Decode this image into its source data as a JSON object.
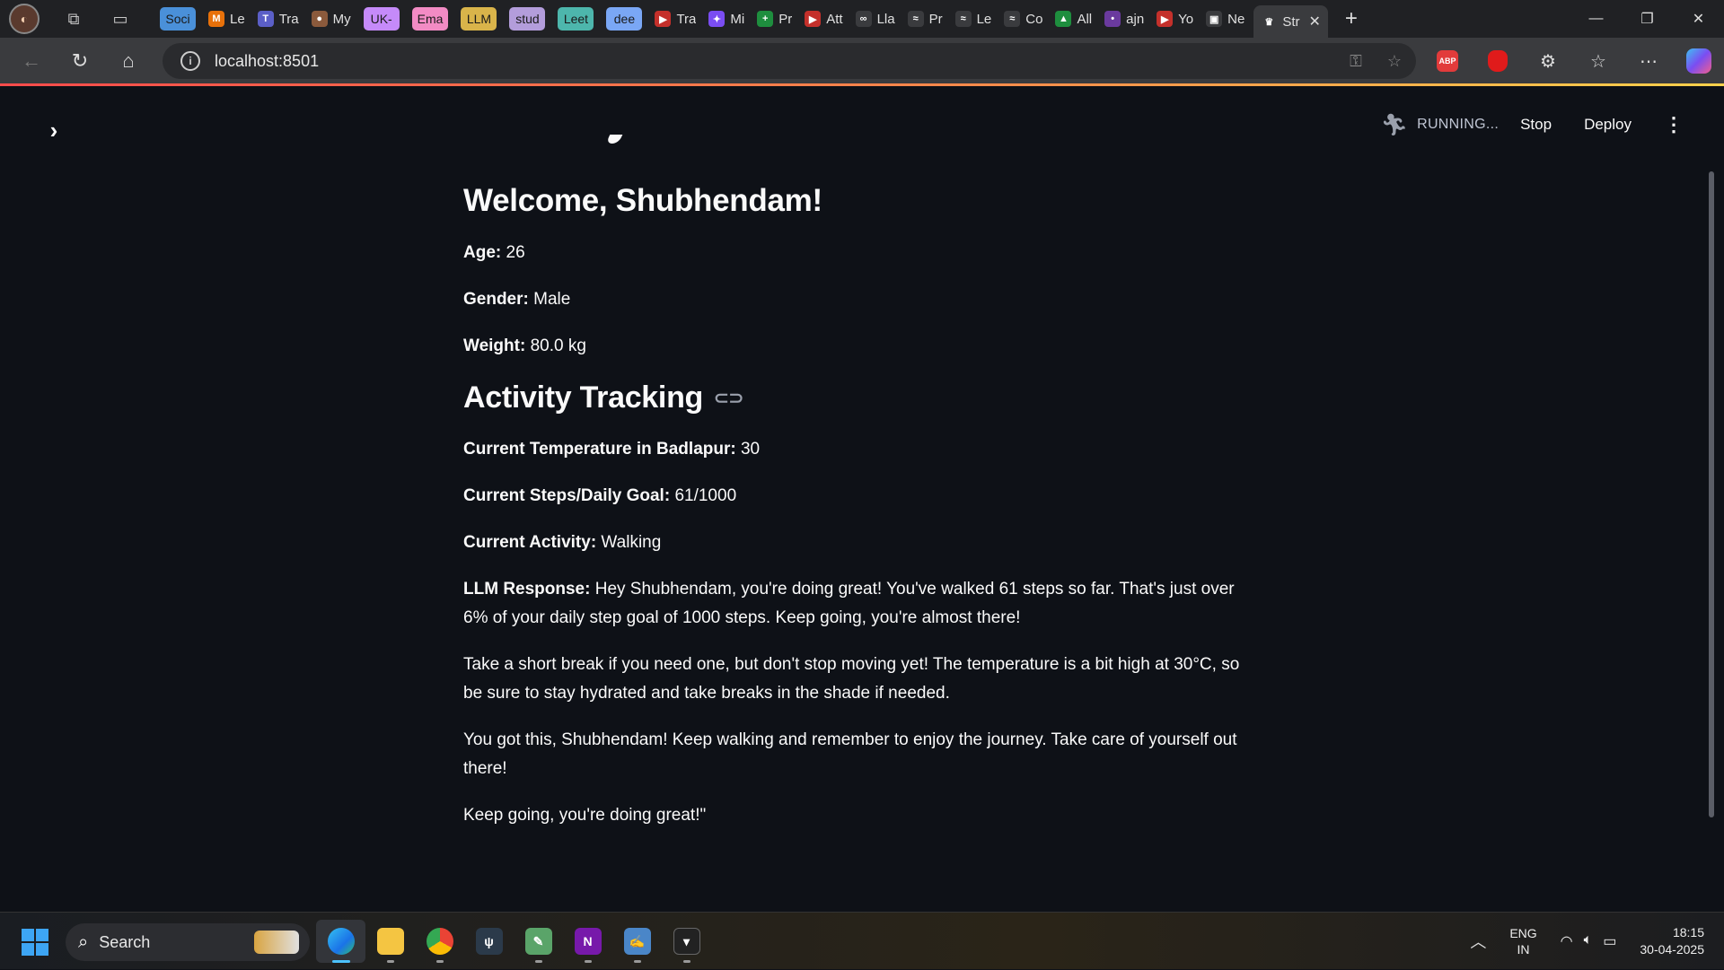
{
  "browser": {
    "tabs": [
      {
        "label": "Soci",
        "chip": true,
        "color": "#4a90d9"
      },
      {
        "label": "Le",
        "fav": "M",
        "favcolor": "#e8710a"
      },
      {
        "label": "Tra",
        "fav": "T",
        "favcolor": "#5b5fc7"
      },
      {
        "label": "My",
        "fav": "●",
        "favcolor": "#8b5a3c"
      },
      {
        "label": "UK-",
        "chip": true,
        "color": "#c58af9"
      },
      {
        "label": "Ema",
        "chip": true,
        "color": "#f28bc4"
      },
      {
        "label": "LLM",
        "chip": true,
        "color": "#d9b44a"
      },
      {
        "label": "stud",
        "chip": true,
        "color": "#b39ddb"
      },
      {
        "label": "Leet",
        "chip": true,
        "color": "#4db6ac"
      },
      {
        "label": "dee",
        "chip": true,
        "color": "#7aa7f5"
      },
      {
        "label": "Tra",
        "fav": "▶",
        "favcolor": "#c4302b"
      },
      {
        "label": "Mi",
        "fav": "✦",
        "favcolor": "#7a4df2"
      },
      {
        "label": "Pr",
        "fav": "+",
        "favcolor": "#1e8e3e"
      },
      {
        "label": "Att",
        "fav": "▶",
        "favcolor": "#c4302b"
      },
      {
        "label": "Lla",
        "fav": "∞",
        "favcolor": "#3a3b3e"
      },
      {
        "label": "Pr",
        "fav": "≈",
        "favcolor": "#3a3b3e"
      },
      {
        "label": "Le",
        "fav": "≈",
        "favcolor": "#3a3b3e"
      },
      {
        "label": "Co",
        "fav": "≈",
        "favcolor": "#3a3b3e"
      },
      {
        "label": "All",
        "fav": "▲",
        "favcolor": "#1e8e3e"
      },
      {
        "label": "ajn",
        "fav": "•",
        "favcolor": "#6a3a9e"
      },
      {
        "label": "Yo",
        "fav": "▶",
        "favcolor": "#c4302b"
      },
      {
        "label": "Ne",
        "fav": "▣",
        "favcolor": "#3a3b3e"
      },
      {
        "label": "Str",
        "fav": "♛",
        "favcolor": "#3a3b3e"
      }
    ],
    "active_tab_label": "",
    "url": "localhost:8501"
  },
  "app": {
    "status": "RUNNING...",
    "stop_label": "Stop",
    "deploy_label": "Deploy",
    "welcome_title": "Welcome, Shubhendam!",
    "age_label": "Age:",
    "age_value": " 26",
    "gender_label": "Gender:",
    "gender_value": " Male",
    "weight_label": "Weight:",
    "weight_value": " 80.0 kg",
    "section_title": "Activity Tracking",
    "temp_label": "Current Temperature in Badlapur:",
    "temp_value": " 30",
    "steps_label": "Current Steps/Daily Goal:",
    "steps_value": " 61/1000",
    "activity_label": "Current Activity:",
    "activity_value": " Walking",
    "llm_label": "LLM Response:",
    "llm_p1": " Hey Shubhendam, you're doing great! You've walked 61 steps so far. That's just over 6% of your daily step goal of 1000 steps. Keep going, you're almost there!",
    "llm_p2": "Take a short break if you need one, but don't stop moving yet! The temperature is a bit high at 30°C, so be sure to stay hydrated and take breaks in the shade if needed.",
    "llm_p3": "You got this, Shubhendam! Keep walking and remember to enjoy the journey. Take care of yourself out there!",
    "llm_p4": "Keep going, you're doing great!\""
  },
  "taskbar": {
    "search_placeholder": "Search",
    "lang_line1": "ENG",
    "lang_line2": "IN",
    "time": "18:15",
    "date": "30-04-2025"
  }
}
